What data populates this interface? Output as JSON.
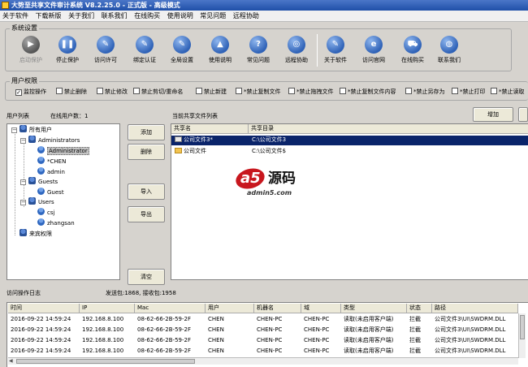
{
  "window": {
    "title": "大势至共享文件审计系统 V8.2.25.0 - 正式版 - 高级模式"
  },
  "menu": [
    "关于软件",
    "下载新版",
    "关于我们",
    "联系我们",
    "在线购买",
    "使用说明",
    "常见问题",
    "远程协助"
  ],
  "system_settings": {
    "title": "系统设置",
    "buttons": [
      {
        "label": "启动保护",
        "icon": "play-icon",
        "disabled": true
      },
      {
        "label": "停止保护",
        "icon": "pause-icon",
        "disabled": false
      },
      {
        "label": "访问许可",
        "icon": "wrench-icon",
        "disabled": false
      },
      {
        "label": "绑定认证",
        "icon": "wrench-icon",
        "disabled": false
      },
      {
        "label": "全局设置",
        "icon": "wrench-icon",
        "disabled": false
      },
      {
        "label": "使用说明",
        "icon": "graduation-cap-icon",
        "disabled": false
      },
      {
        "label": "常见问题",
        "icon": "question-icon",
        "disabled": false
      },
      {
        "label": "远程协助",
        "icon": "remote-assist-icon",
        "disabled": false
      },
      {
        "label": "关于软件",
        "icon": "wrench-icon",
        "disabled": false
      },
      {
        "label": "访问官网",
        "icon": "ie-icon",
        "disabled": false
      },
      {
        "label": "在线购买",
        "icon": "cart-icon",
        "disabled": false
      },
      {
        "label": "联系我们",
        "icon": "globe-icon",
        "disabled": false
      }
    ]
  },
  "permissions": {
    "title": "用户权限",
    "items": [
      {
        "label": "监控操作",
        "checked": true
      },
      {
        "label": "禁止删除",
        "checked": false
      },
      {
        "label": "禁止修改",
        "checked": false
      },
      {
        "label": "禁止剪切/重命名",
        "checked": false
      },
      {
        "label": "禁止新建",
        "checked": false
      },
      {
        "label": "*禁止复制文件",
        "checked": false
      },
      {
        "label": "*禁止拖拽文件",
        "checked": false
      },
      {
        "label": "*禁止复制文件内容",
        "checked": false
      },
      {
        "label": "*禁止另存为",
        "checked": false
      },
      {
        "label": "*禁止打印",
        "checked": false
      },
      {
        "label": "*禁止读取",
        "checked": false
      }
    ]
  },
  "user_list": {
    "label": "用户列表",
    "online_label": "在线用户数：1",
    "tree": [
      {
        "label": "所有用户",
        "level": 0,
        "kind": "group"
      },
      {
        "label": "Administrators",
        "level": 1,
        "kind": "group"
      },
      {
        "label": "Administrator",
        "level": 2,
        "kind": "user",
        "selected": true
      },
      {
        "label": "*CHEN",
        "level": 2,
        "kind": "user"
      },
      {
        "label": "admin",
        "level": 2,
        "kind": "user"
      },
      {
        "label": "Guests",
        "level": 1,
        "kind": "group"
      },
      {
        "label": "Guest",
        "level": 2,
        "kind": "user"
      },
      {
        "label": "Users",
        "level": 1,
        "kind": "group"
      },
      {
        "label": "csj",
        "level": 2,
        "kind": "user"
      },
      {
        "label": "zhangsan",
        "level": 2,
        "kind": "user"
      },
      {
        "label": "来宾权限",
        "level": 0,
        "kind": "group"
      }
    ]
  },
  "side_buttons": {
    "add": "添加",
    "delete": "删除",
    "import": "导入",
    "export": "导出",
    "clear": "清空"
  },
  "shares": {
    "label": "当前共享文件列表",
    "add_button": "增加",
    "columns": [
      "共享名",
      "共享目录"
    ],
    "rows": [
      {
        "name": "公司文件3*",
        "path": "C:\\公司文件3",
        "selected": true
      },
      {
        "name": "公司文件",
        "path": "C:\\公司文件$",
        "selected": false
      }
    ]
  },
  "watermark": {
    "text1": "a5",
    "text2": "源码",
    "domain": "admin5.com"
  },
  "log": {
    "label": "访问操作日志",
    "packets": "发送包:1868, 接收包:1958",
    "columns": [
      "时间",
      "IP",
      "Mac",
      "用户",
      "机器名",
      "域",
      "类型",
      "状态",
      "路径"
    ],
    "rows": [
      [
        "2016-09-22 14:59:24",
        "192.168.8.100",
        "08-62-66-2B-59-2F",
        "CHEN",
        "CHEN-PC",
        "CHEN-PC",
        "读取(未启用客户端)",
        "拦截",
        "公司文件3\\UI\\SWDRM.DLL"
      ],
      [
        "2016-09-22 14:59:24",
        "192.168.8.100",
        "08-62-66-2B-59-2F",
        "CHEN",
        "CHEN-PC",
        "CHEN-PC",
        "读取(未启用客户端)",
        "拦截",
        "公司文件3\\UI\\SWDRM.DLL"
      ],
      [
        "2016-09-22 14:59:24",
        "192.168.8.100",
        "08-62-66-2B-59-2F",
        "CHEN",
        "CHEN-PC",
        "CHEN-PC",
        "读取(未启用客户端)",
        "拦截",
        "公司文件3\\UI\\SWDRM.DLL"
      ],
      [
        "2016-09-22 14:59:24",
        "192.168.8.100",
        "08-62-66-2B-59-2F",
        "CHEN",
        "CHEN-PC",
        "CHEN-PC",
        "读取(未启用客户端)",
        "拦截",
        "公司文件3\\UI\\SWDRM.DLL"
      ]
    ]
  }
}
